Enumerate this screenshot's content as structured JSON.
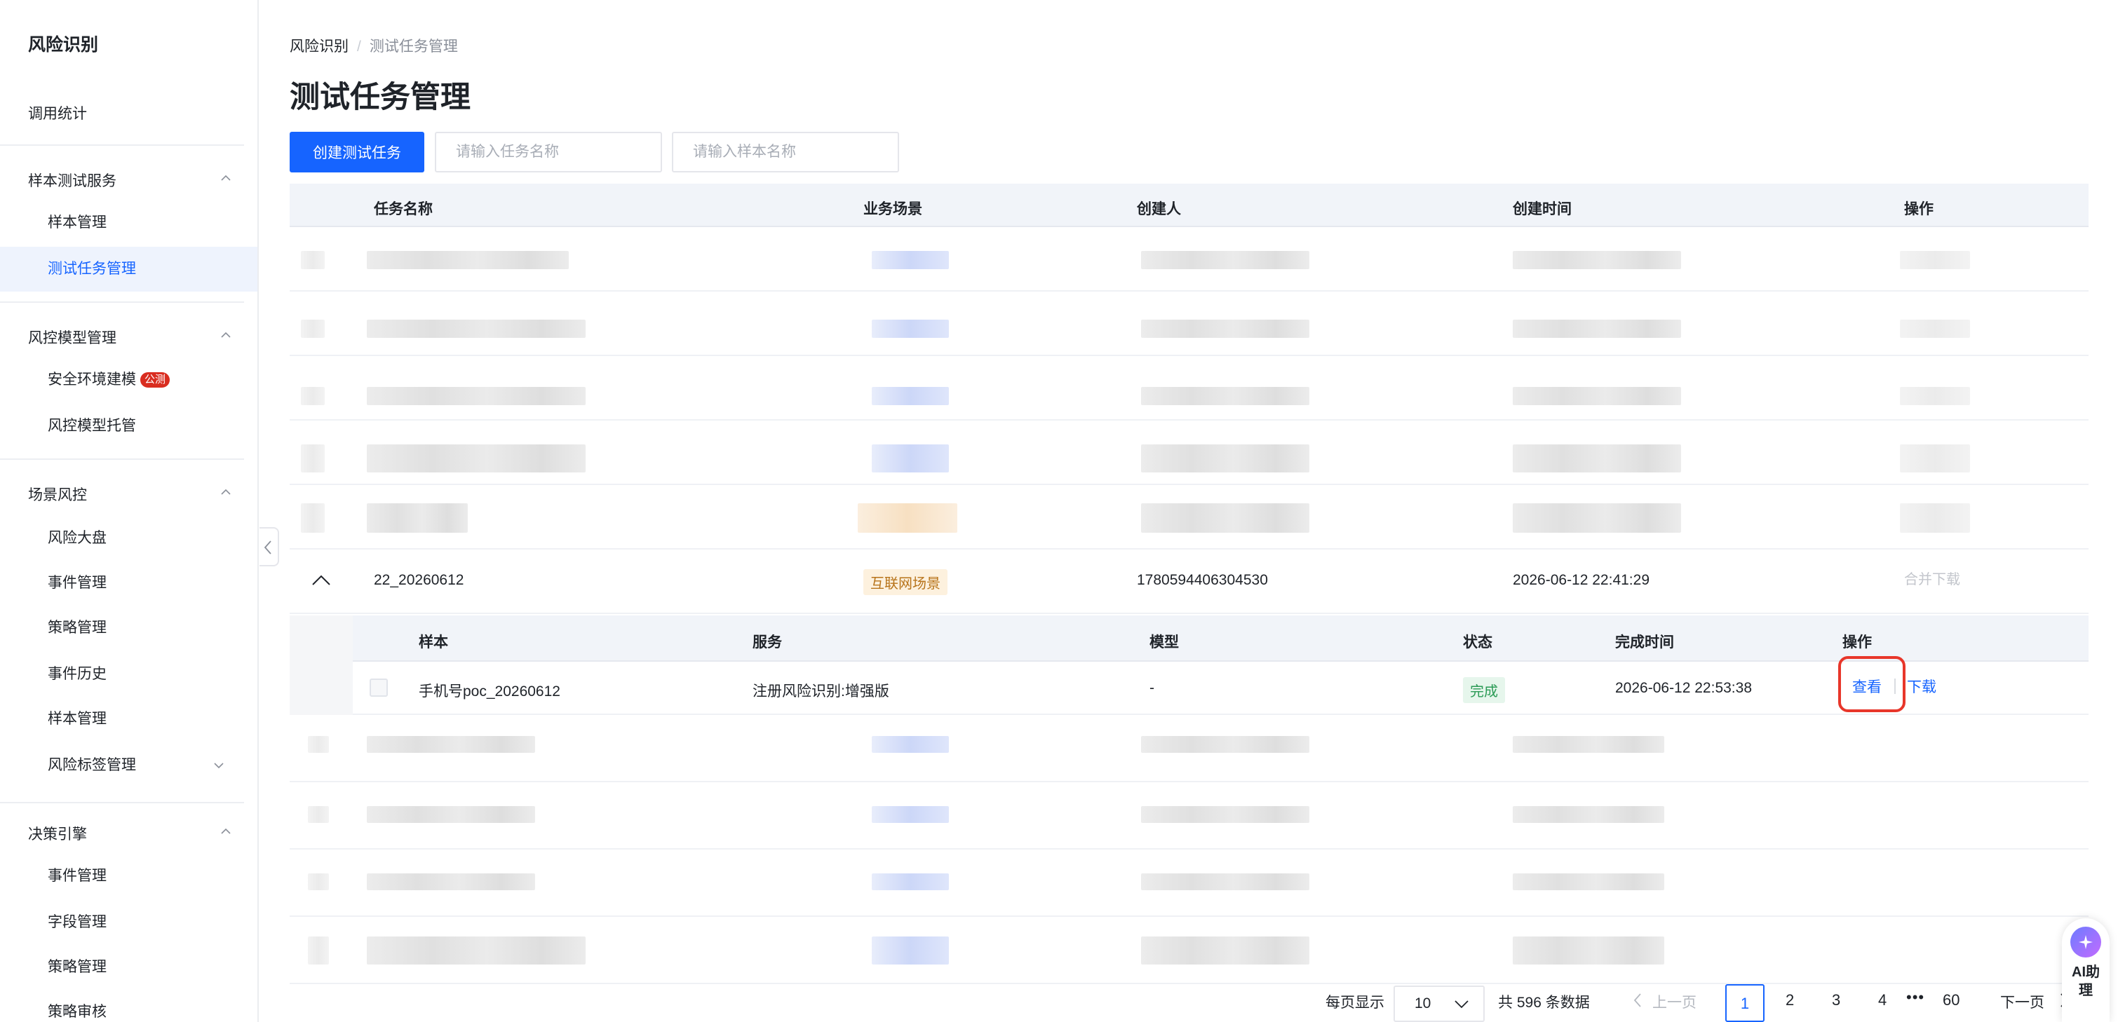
{
  "sidebar": {
    "title": "风险识别",
    "single": "调用统计",
    "groups": [
      {
        "label": "样本测试服务",
        "items": [
          "样本管理",
          "测试任务管理"
        ]
      },
      {
        "label": "风控模型管理",
        "items": [
          "安全环境建模",
          "风控模型托管"
        ],
        "badge": "公测"
      },
      {
        "label": "场景风控",
        "items": [
          "风险大盘",
          "事件管理",
          "策略管理",
          "事件历史",
          "样本管理",
          "风险标签管理"
        ]
      },
      {
        "label": "决策引擎",
        "items": [
          "事件管理",
          "字段管理",
          "策略管理",
          "策略审核"
        ]
      }
    ],
    "active_item": "测试任务管理"
  },
  "breadcrumb": {
    "root": "风险识别",
    "current": "测试任务管理"
  },
  "page_title": "测试任务管理",
  "toolbar": {
    "create_button": "创建测试任务",
    "task_name_placeholder": "请输入任务名称",
    "sample_name_placeholder": "请输入样本名称"
  },
  "table": {
    "columns": [
      "任务名称",
      "业务场景",
      "创建人",
      "创建时间",
      "操作"
    ],
    "expanded_row": {
      "task_name": "22_20260612",
      "scene": "互联网场景",
      "creator": "1780594406304530",
      "created_at": "2026-06-12 22:41:29",
      "action": "合并下载"
    },
    "sub_columns": [
      "样本",
      "服务",
      "模型",
      "状态",
      "完成时间",
      "操作"
    ],
    "sub_row": {
      "sample": "手机号poc_20260612",
      "service": "注册风险识别:增强版",
      "model": "-",
      "status": "完成",
      "finished_at": "2026-06-12 22:53:38",
      "view": "查看",
      "download": "下载"
    }
  },
  "pagination": {
    "per_page_label": "每页显示",
    "page_size": "10",
    "total": "共 596 条数据",
    "prev": "上一页",
    "next": "下一页",
    "pages": [
      "1",
      "2",
      "3",
      "4"
    ],
    "ellipsis": "•••",
    "last_page": "60",
    "current": "1"
  },
  "ai_assistant": {
    "label": "AI助理"
  },
  "colors": {
    "primary": "#1664ff",
    "highlight": "#e8362a",
    "success": "#2a9b55",
    "warning_tag": "#b8741a"
  }
}
